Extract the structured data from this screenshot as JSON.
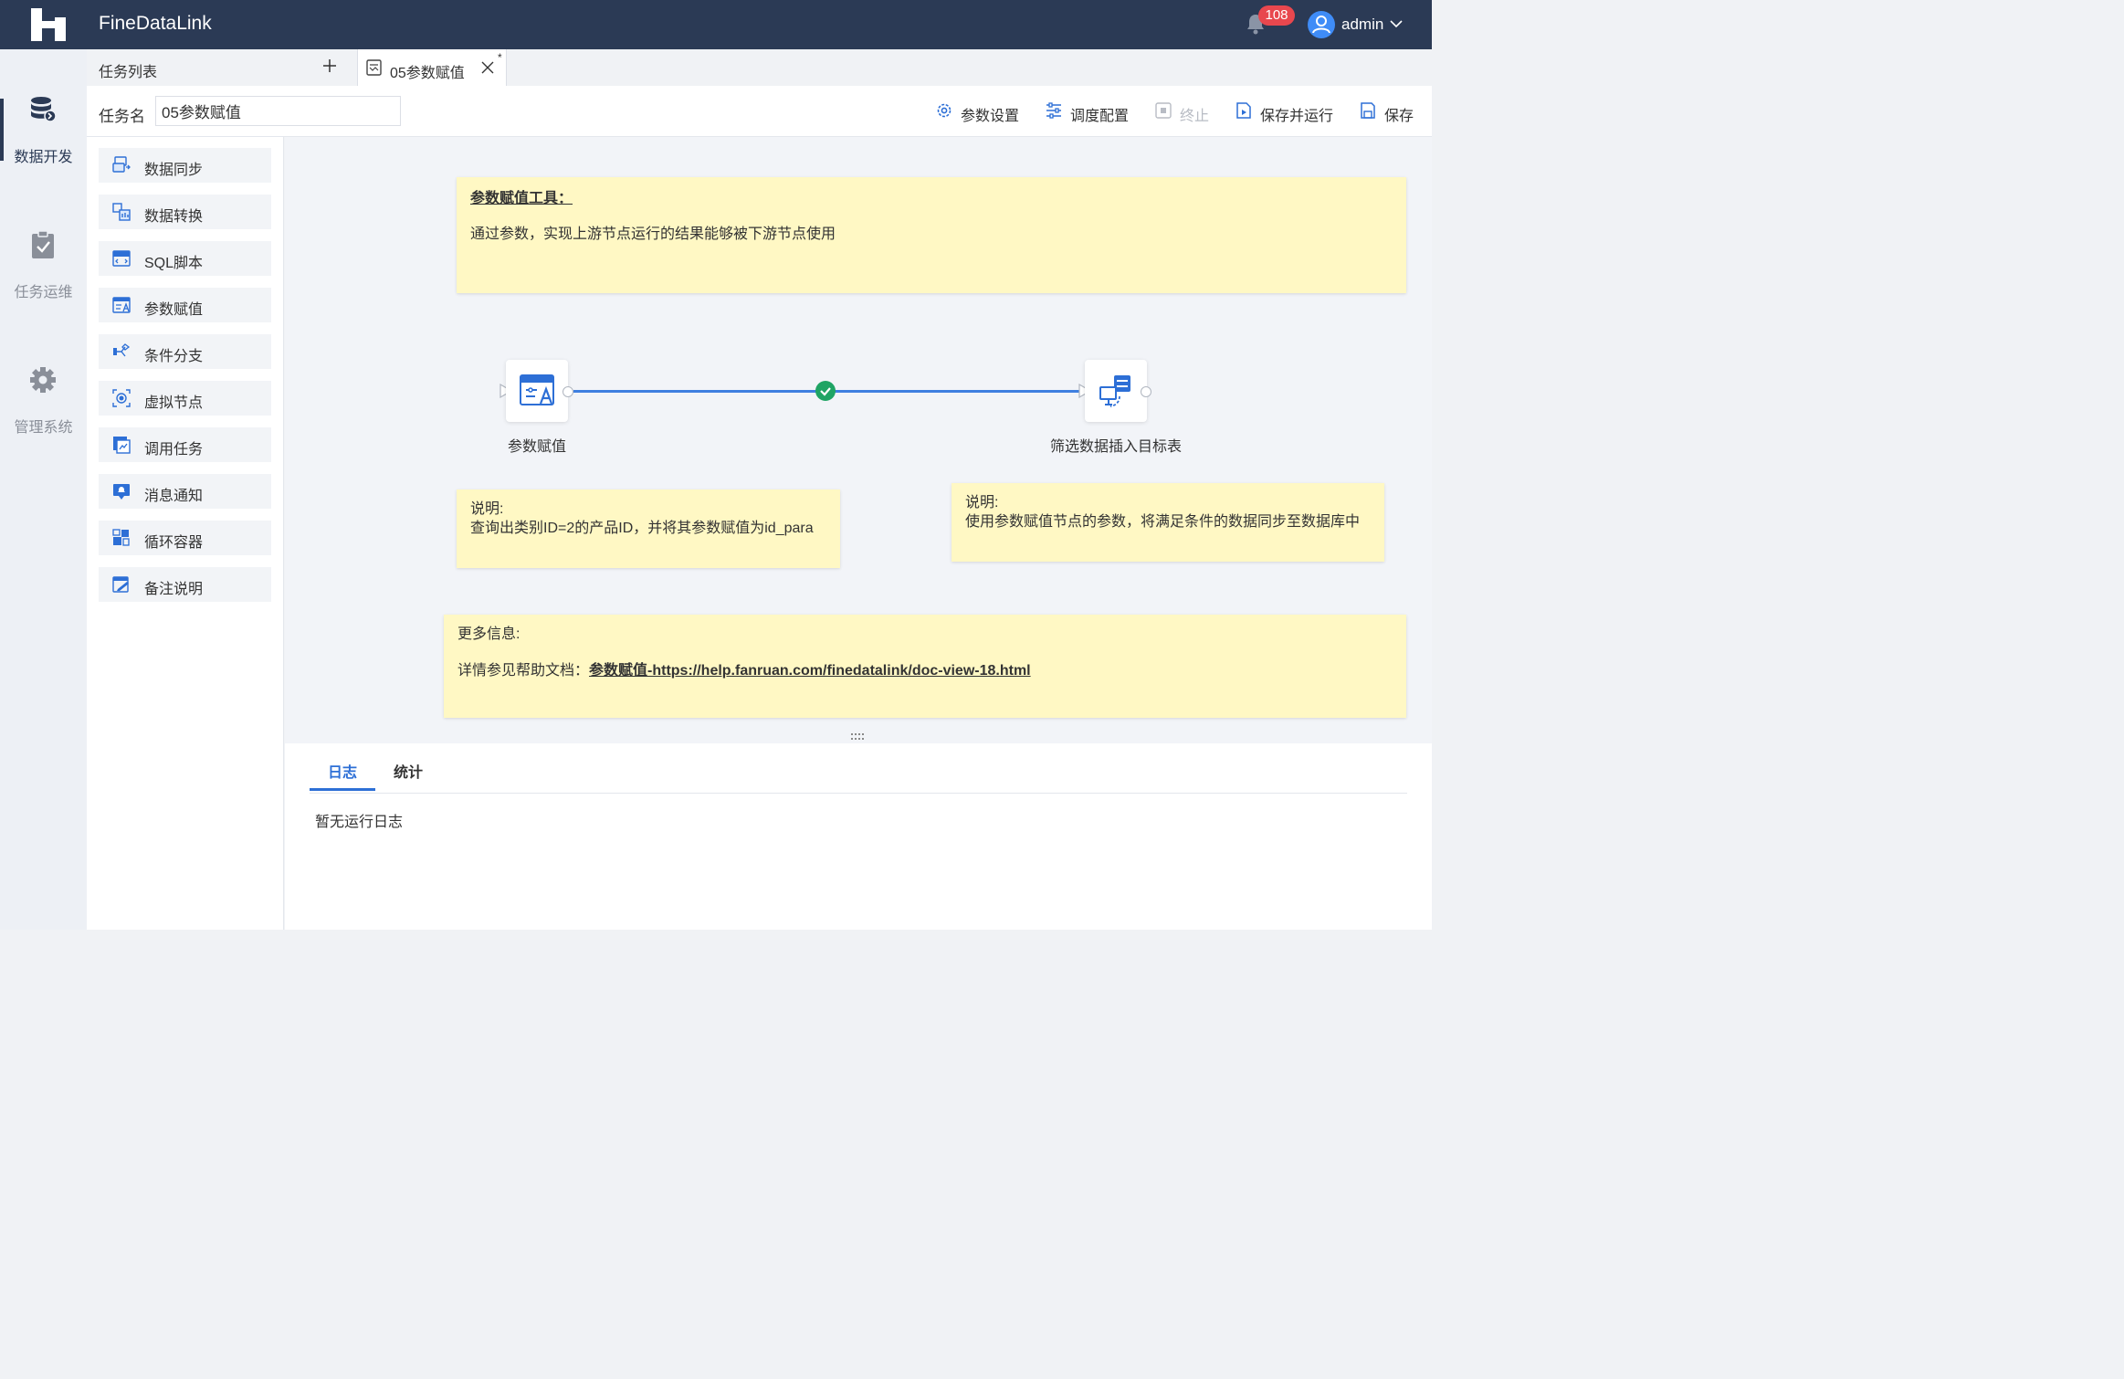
{
  "app": {
    "title": "FineDataLink"
  },
  "header": {
    "notification_count": "108",
    "user_name": "admin"
  },
  "left_nav": [
    {
      "label": "数据开发",
      "icon": "database-icon",
      "active": true
    },
    {
      "label": "任务运维",
      "icon": "clipboard-check-icon",
      "active": false
    },
    {
      "label": "管理系统",
      "icon": "gear-icon",
      "active": false
    }
  ],
  "tabs": {
    "list_label": "任务列表",
    "open_tab": "05参数赋值",
    "dirty_marker": "*"
  },
  "task": {
    "name_label": "任务名",
    "name_value": "05参数赋值"
  },
  "toolbar": {
    "param_settings": "参数设置",
    "schedule_config": "调度配置",
    "terminate": "终止",
    "save_and_run": "保存并运行",
    "save": "保存"
  },
  "components": [
    "数据同步",
    "数据转换",
    "SQL脚本",
    "参数赋值",
    "条件分支",
    "虚拟节点",
    "调用任务",
    "消息通知",
    "循环容器",
    "备注说明"
  ],
  "canvas": {
    "notes": {
      "intro_title": "参数赋值工具：",
      "intro_body": "通过参数，实现上游节点运行的结果能够被下游节点使用",
      "left_heading": "说明:",
      "left_body": "查询出类别ID=2的产品ID，并将其参数赋值为id_para",
      "right_heading": "说明:",
      "right_body": "使用参数赋值节点的参数，将满足条件的数据同步至数据库中",
      "more_heading": "更多信息:",
      "more_prefix": "详情参见帮助文档：",
      "more_link": "参数赋值-https://help.fanruan.com/finedatalink/doc-view-18.html"
    },
    "nodes": {
      "source": "参数赋值",
      "target": "筛选数据插入目标表"
    },
    "edge_status": "success"
  },
  "log": {
    "tabs": [
      "日志",
      "统计"
    ],
    "active_tab": "日志",
    "empty_text": "暂无运行日志"
  },
  "colors": {
    "topbar": "#2b3a55",
    "accent": "#2d6fd6",
    "note": "#fff8c4",
    "badge": "#e8474e",
    "success": "#1fa464"
  }
}
